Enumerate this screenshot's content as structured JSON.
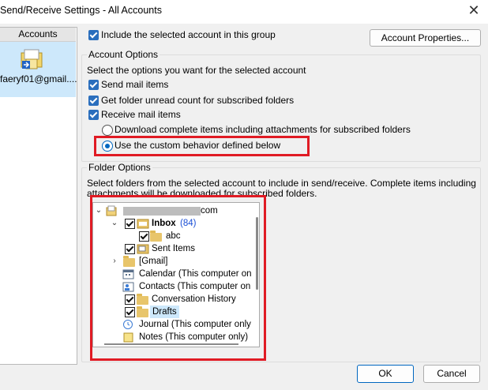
{
  "window": {
    "title": "Send/Receive Settings - All Accounts",
    "close_glyph": "✕"
  },
  "accounts_panel": {
    "header": "Accounts",
    "account_label": "faeryf01@gmail....",
    "icon": "mail-account-icon"
  },
  "include_checkbox": {
    "label": "Include the selected account in this group",
    "checked": true
  },
  "account_properties_button": "Account Properties...",
  "account_options": {
    "title": "Account Options",
    "instruction": "Select the options you want for the selected account",
    "send_mail": {
      "label": "Send mail items",
      "checked": true
    },
    "unread_count": {
      "label": "Get folder unread count for subscribed folders",
      "checked": true
    },
    "receive_mail": {
      "label": "Receive mail items",
      "checked": true
    },
    "radio_download_complete": {
      "label": "Download complete items including attachments for subscribed folders",
      "selected": false
    },
    "radio_custom": {
      "label": "Use the custom behavior defined below",
      "selected": true
    }
  },
  "folder_options": {
    "title": "Folder Options",
    "instruction_line1": "Select folders from the selected account to include in send/receive. Complete items including",
    "instruction_line2": "attachments will be downloaded for subscribed folders.",
    "tree": [
      {
        "label": "com",
        "redacted": true,
        "expanded": true,
        "icon": "mailbox-icon"
      },
      {
        "label": "Inbox",
        "count": "(84)",
        "checked": true,
        "expanded": true,
        "icon": "inbox-icon"
      },
      {
        "label": "abc",
        "checked": true,
        "icon": "folder-icon"
      },
      {
        "label": "Sent Items",
        "checked": true,
        "icon": "sent-icon"
      },
      {
        "label": "[Gmail]",
        "collapsed": true,
        "icon": "folder-icon"
      },
      {
        "label": "Calendar (This computer on",
        "icon": "calendar-icon"
      },
      {
        "label": "Contacts (This computer on",
        "icon": "contacts-icon"
      },
      {
        "label": "Conversation History",
        "checked": true,
        "icon": "folder-icon"
      },
      {
        "label": "Drafts",
        "checked": true,
        "selected": true,
        "icon": "folder-icon"
      },
      {
        "label": "Journal (This computer only",
        "icon": "journal-icon"
      },
      {
        "label": "Notes (This computer only)",
        "icon": "notes-icon"
      }
    ]
  },
  "buttons": {
    "ok": "OK",
    "cancel": "Cancel"
  },
  "colors": {
    "accent": "#0067c0",
    "highlight": "#e01b24",
    "selection": "#cde8fb"
  }
}
